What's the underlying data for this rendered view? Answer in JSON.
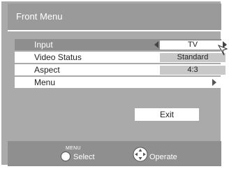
{
  "menu": {
    "title": "Front Menu",
    "rows": [
      {
        "label": "Input",
        "value": "TV"
      },
      {
        "label": "Video Status",
        "value": "Standard"
      },
      {
        "label": "Aspect",
        "value": "4:3"
      },
      {
        "label": "Menu"
      }
    ],
    "exit_label": "Exit"
  },
  "footer": {
    "select_caption": "MENU",
    "select_label": "Select",
    "operate_label": "Operate"
  },
  "icons": {
    "left_arrow": "triangle-left-icon",
    "right_arrow": "triangle-right-icon",
    "submenu_arrow": "triangle-right-icon",
    "cursor": "pointer-cursor-icon",
    "select": "menu-button-icon",
    "operate": "joystick-icon"
  },
  "colors": {
    "background": "#aaaaaa",
    "title_bar": "#9a9a9a",
    "selected_row": "#8e8e8e",
    "row": "#ffffff",
    "value_box": "#c8c8c8",
    "footer": "#8f8f8f"
  }
}
